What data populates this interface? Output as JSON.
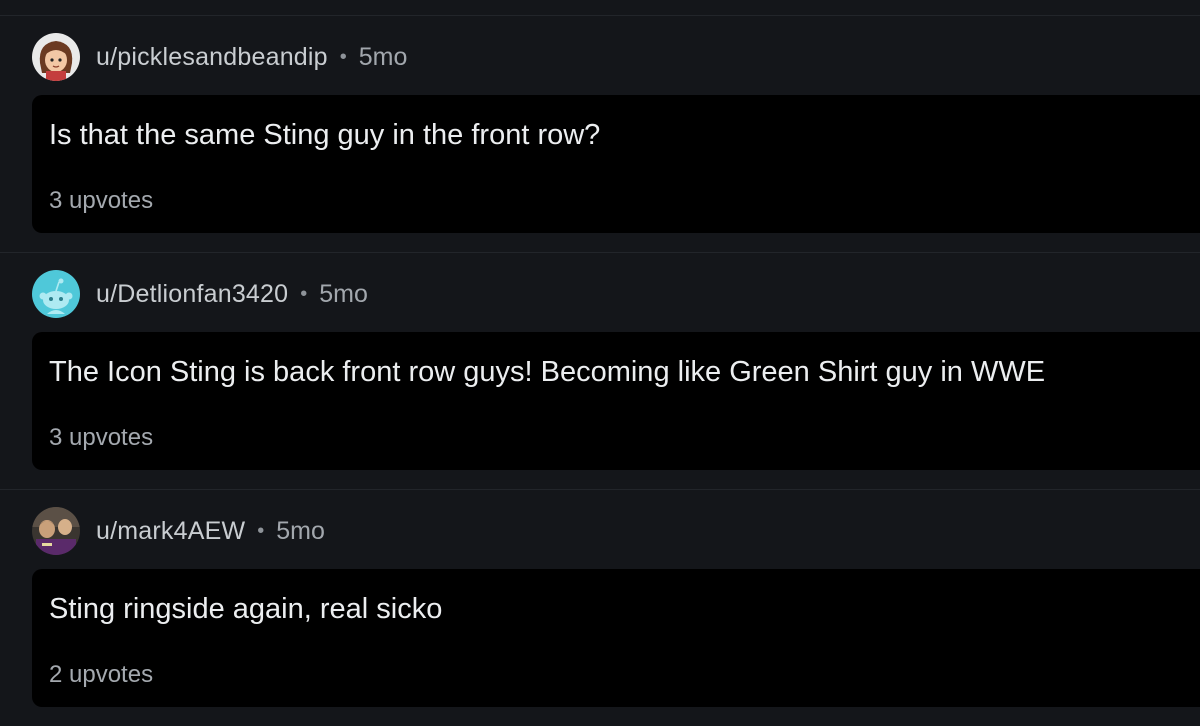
{
  "comments": [
    {
      "username": "u/picklesandbeandip",
      "separator": "•",
      "age": "5mo",
      "text": "Is that the same Sting guy in the front row?",
      "upvotes": "3 upvotes",
      "avatar": "cartoon-person-avatar"
    },
    {
      "username": "u/Detlionfan3420",
      "separator": "•",
      "age": "5mo",
      "text": "The Icon Sting is back front row guys! Becoming like Green Shirt guy in WWE",
      "upvotes": "3 upvotes",
      "avatar": "reddit-snoo-avatar"
    },
    {
      "username": "u/mark4AEW",
      "separator": "•",
      "age": "5mo",
      "text": "Sting ringside again, real sicko",
      "upvotes": "2 upvotes",
      "avatar": "photo-avatar"
    }
  ],
  "colors": {
    "background": "#14161a",
    "bubble": "#000000",
    "snoo_bg": "#4fc8d9"
  }
}
